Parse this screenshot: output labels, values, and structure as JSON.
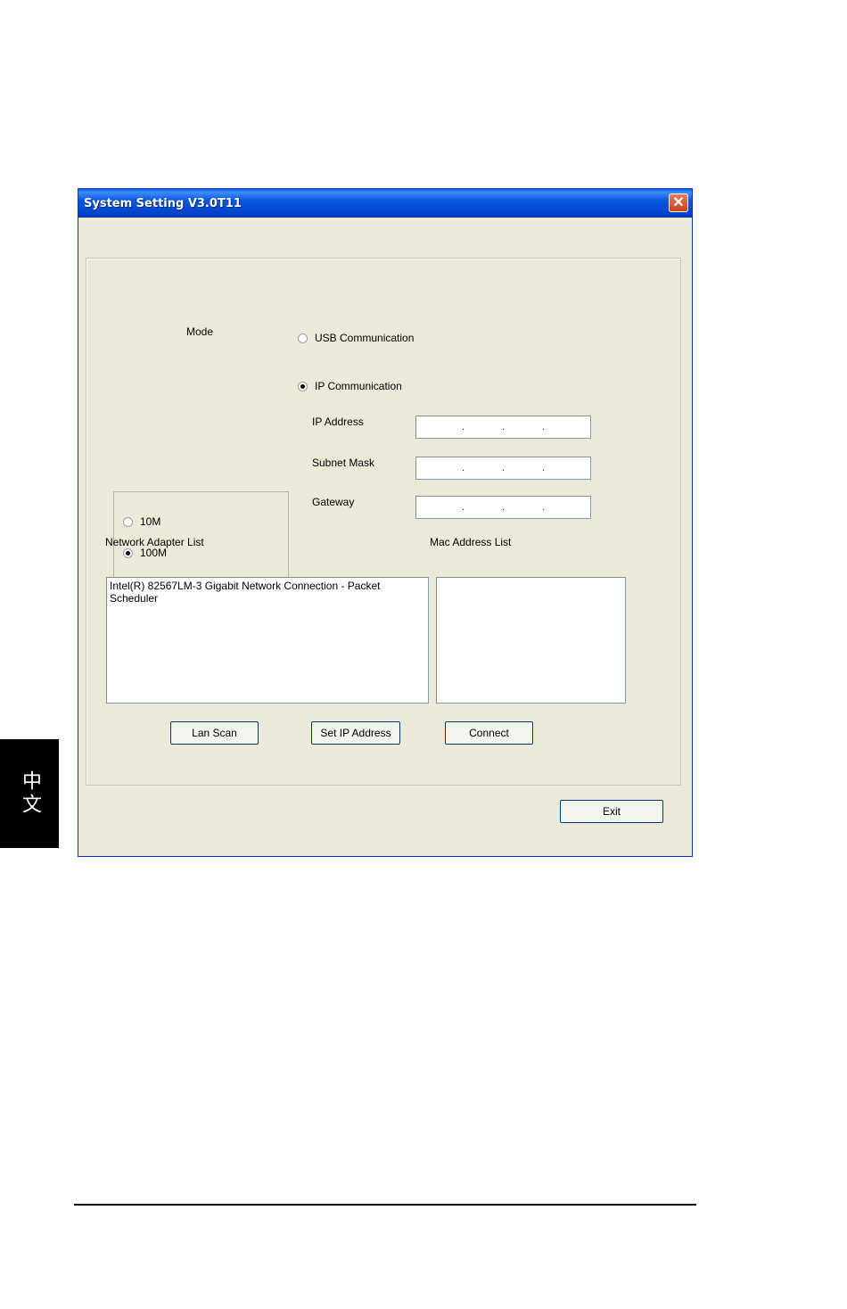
{
  "side_tab": {
    "label": "中文"
  },
  "window": {
    "title": "System Setting V3.0T11",
    "close_glyph": "✕"
  },
  "mode": {
    "label": "Mode",
    "usb_label": "USB Communication",
    "usb_selected": false,
    "ip_label": "IP Communication",
    "ip_selected": true
  },
  "speed": {
    "option_10m": "10M",
    "option_100m": "100M",
    "selected": "100M"
  },
  "ip_fields": {
    "ip_address_label": "IP Address",
    "subnet_mask_label": "Subnet Mask",
    "gateway_label": "Gateway",
    "separator": "."
  },
  "network_adapter_list": {
    "label": "Network Adapter List",
    "items": [
      "Intel(R) 82567LM-3 Gigabit Network Connection - Packet Scheduler"
    ]
  },
  "mac_address_list": {
    "label": "Mac Address List",
    "items": []
  },
  "buttons": {
    "lan_scan": "Lan Scan",
    "set_ip_address": "Set IP Address",
    "connect": "Connect",
    "exit": "Exit"
  },
  "colors": {
    "window_bg": "#ECE9D8",
    "titlebar": "#0A57E0",
    "close_button": "#C9411C"
  },
  "icons": {
    "close": "close-icon"
  }
}
